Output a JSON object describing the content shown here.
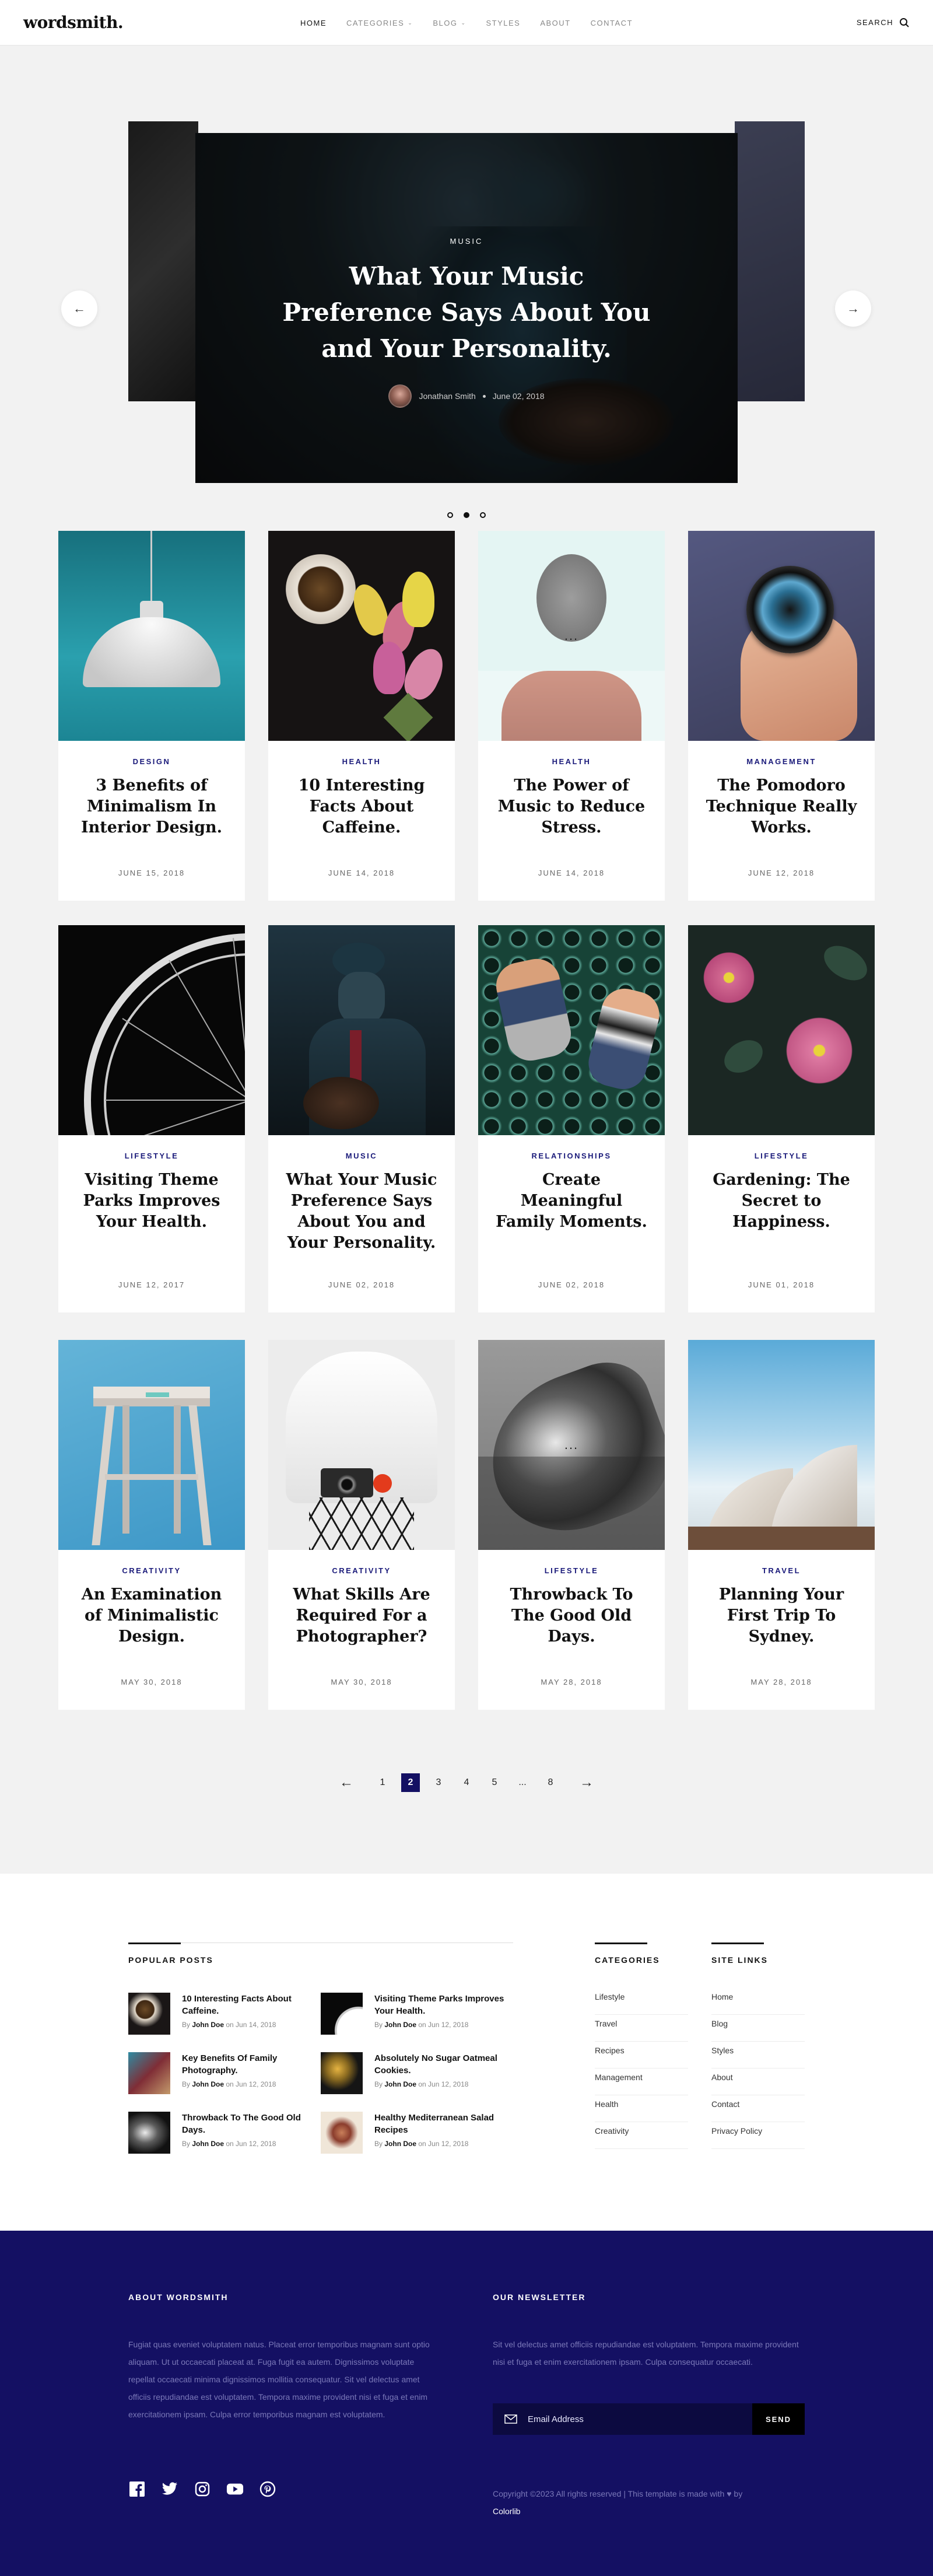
{
  "header": {
    "logo": "wordsmith.",
    "nav": [
      {
        "label": "HOME",
        "active": true,
        "dropdown": false
      },
      {
        "label": "CATEGORIES",
        "active": false,
        "dropdown": true
      },
      {
        "label": "BLOG",
        "active": false,
        "dropdown": true
      },
      {
        "label": "STYLES",
        "active": false,
        "dropdown": false
      },
      {
        "label": "ABOUT",
        "active": false,
        "dropdown": false
      },
      {
        "label": "CONTACT",
        "active": false,
        "dropdown": false
      }
    ],
    "search_label": "SEARCH"
  },
  "hero": {
    "category": "MUSIC",
    "title": "What Your Music Preference Says About You and Your Personality.",
    "author": "Jonathan Smith",
    "date": "June 02, 2018",
    "prev_icon": "←",
    "next_icon": "→",
    "dots": 3,
    "active_dot": 1
  },
  "cards": [
    {
      "category": "DESIGN",
      "title": "3 Benefits of Minimalism In Interior Design.",
      "date": "JUNE 15, 2018",
      "image": "pendant-lamp-teal"
    },
    {
      "category": "HEALTH",
      "title": "10 Interesting Facts About Caffeine.",
      "date": "JUNE 14, 2018",
      "image": "coffee-tulips"
    },
    {
      "category": "HEALTH",
      "title": "The Power of Music to Reduce Stress.",
      "date": "JUNE 14, 2018",
      "image": "man-headphones",
      "more": "..."
    },
    {
      "category": "MANAGEMENT",
      "title": "The Pomodoro Technique Really Works.",
      "date": "JUNE 12, 2018",
      "image": "watch-hand"
    },
    {
      "category": "LIFESTYLE",
      "title": "Visiting Theme Parks Improves Your Health.",
      "date": "JUNE 12, 2017",
      "image": "ferris-wheel"
    },
    {
      "category": "MUSIC",
      "title": "What Your Music Preference Says About You and Your Personality.",
      "date": "JUNE 02, 2018",
      "image": "guitarist"
    },
    {
      "category": "RELATIONSHIPS",
      "title": "Create Meaningful Family Moments.",
      "date": "JUNE 02, 2018",
      "image": "jumping-couple"
    },
    {
      "category": "LIFESTYLE",
      "title": "Gardening: The Secret to Happiness.",
      "date": "JUNE 01, 2018",
      "image": "pink-flowers"
    },
    {
      "category": "CREATIVITY",
      "title": "An Examination of Minimalistic Design.",
      "date": "MAY 30, 2018",
      "image": "stool"
    },
    {
      "category": "CREATIVITY",
      "title": "What Skills Are Required For a Photographer?",
      "date": "MAY 30, 2018",
      "image": "chair-camera"
    },
    {
      "category": "LIFESTYLE",
      "title": "Throwback To The Good Old Days.",
      "date": "MAY 28, 2018",
      "image": "vintage-car",
      "more": "..."
    },
    {
      "category": "TRAVEL",
      "title": "Planning Your First Trip To Sydney.",
      "date": "MAY 28, 2018",
      "image": "sydney-opera"
    }
  ],
  "pagination": {
    "prev": "←",
    "next": "→",
    "pages": [
      "1",
      "2",
      "3",
      "4",
      "5",
      "...",
      "8"
    ],
    "current": "2"
  },
  "popular": {
    "heading": "POPULAR POSTS",
    "posts": [
      {
        "title": "10 Interesting Facts About Caffeine.",
        "by": "By",
        "author": "John Doe",
        "on": "on Jun 14, 2018",
        "thumb": "coffee"
      },
      {
        "title": "Visiting Theme Parks Improves Your Health.",
        "by": "By",
        "author": "John Doe",
        "on": "on Jun 12, 2018",
        "thumb": "ferris-wheel"
      },
      {
        "title": "Key Benefits Of Family Photography.",
        "by": "By",
        "author": "John Doe",
        "on": "on Jun 12, 2018",
        "thumb": "family"
      },
      {
        "title": "Absolutely No Sugar Oatmeal Cookies.",
        "by": "By",
        "author": "John Doe",
        "on": "on Jun 12, 2018",
        "thumb": "cookies"
      },
      {
        "title": "Throwback To The Good Old Days.",
        "by": "By",
        "author": "John Doe",
        "on": "on Jun 12, 2018",
        "thumb": "car"
      },
      {
        "title": "Healthy Mediterranean Salad Recipes",
        "by": "By",
        "author": "John Doe",
        "on": "on Jun 12, 2018",
        "thumb": "salad"
      }
    ]
  },
  "categories": {
    "heading": "CATEGORIES",
    "items": [
      "Lifestyle",
      "Travel",
      "Recipes",
      "Management",
      "Health",
      "Creativity"
    ]
  },
  "site_links": {
    "heading": "SITE LINKS",
    "items": [
      "Home",
      "Blog",
      "Styles",
      "About",
      "Contact",
      "Privacy Policy"
    ]
  },
  "footer": {
    "about_heading": "ABOUT WORDSMITH",
    "about_text": "Fugiat quas eveniet voluptatem natus. Placeat error temporibus magnam sunt optio aliquam. Ut ut occaecati placeat at. Fuga fugit ea autem. Dignissimos voluptate repellat occaecati minima dignissimos mollitia consequatur. Sit vel delectus amet officiis repudiandae est voluptatem. Tempora maxime provident nisi et fuga et enim exercitationem ipsam. Culpa error temporibus magnam est voluptatem.",
    "newsletter_heading": "OUR NEWSLETTER",
    "newsletter_text": "Sit vel delectus amet officiis repudiandae est voluptatem. Tempora maxime provident nisi et fuga et enim exercitationem ipsam. Culpa consequatur occaecati.",
    "email_placeholder": "Email Address",
    "send_label": "SEND",
    "copyright": "Copyright ©2023 All rights reserved | This template is made with",
    "by": "by",
    "credit": "Colorlib",
    "socials": [
      "facebook-icon",
      "twitter-icon",
      "instagram-icon",
      "youtube-icon",
      "pinterest-icon"
    ]
  },
  "colors": {
    "accent": "#141063",
    "category_text": "#1a1a7a",
    "background": "#f2f2f2"
  }
}
